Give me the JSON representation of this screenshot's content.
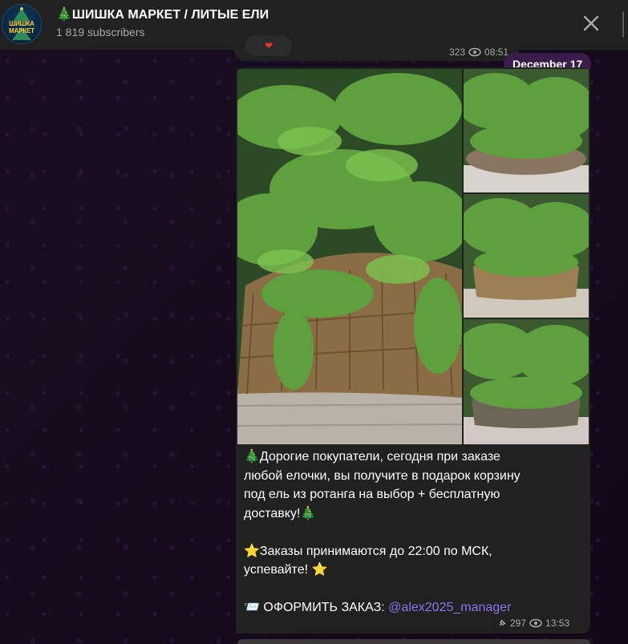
{
  "header": {
    "title": "🎄ШИШКА МАРКЕТ / ЛИТЫЕ ЕЛИ",
    "subscribers": "1 819 subscribers",
    "avatar_text": "ШИШКА МАРКЕТ",
    "close_icon": "close-icon"
  },
  "previous_message": {
    "views": "323",
    "time": "08:51",
    "reaction": "❤"
  },
  "date_separator": "December 17",
  "message": {
    "photos": [
      "tree-basket-main",
      "tree-basket-1",
      "tree-basket-2",
      "tree-basket-3"
    ],
    "lines": [
      "🎄Дорогие покупатели, сегодня при заказе",
      "любой елочки, вы получите в подарок корзину",
      "под ель из ротанга на выбор + бесплатную",
      "доставку!🎄",
      "",
      "⭐Заказы принимаются до 22:00 по МСК,",
      "успевайте! ⭐",
      ""
    ],
    "order_prefix": "📨 ОФОРМИТЬ ЗАКАЗ: ",
    "order_link": "@alex2025_manager",
    "views": "297",
    "time": "13:53"
  },
  "colors": {
    "header_bg": "#212121",
    "bubble_bg": "#212121",
    "link": "#8d74e8",
    "date_pill": "#3a1d4a"
  }
}
